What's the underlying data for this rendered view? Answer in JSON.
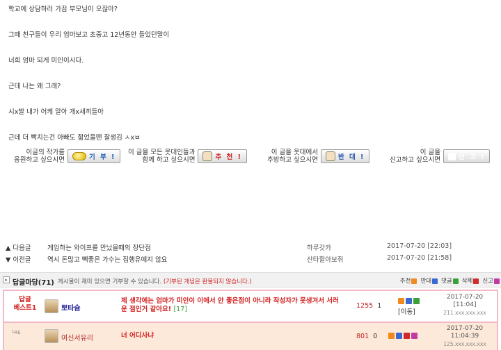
{
  "story": {
    "lines": [
      "학교에 상담하러 가끔 부모님이 오잖아?",
      "그때 친구들이 우리 엄마보고 초중고 12년동안 들었던말이",
      "너희 엄마 되게 미인이시다.",
      "근데 나는 왜 그래?",
      "시x발 내가 어케 알아 개x새끼들아",
      "근데 더 빡치는건 아빠도 젊었을땐 잘생김 ㅅxㅂ"
    ]
  },
  "actions": {
    "donate_text_1": "이글의 작가를",
    "donate_text_2": "응원하고 싶으시면",
    "donate_label": "기 부 !",
    "recommend_text_1": "이 글을 모든 웃대인들과",
    "recommend_text_2": "함께 하고 싶으시면",
    "recommend_label": "추 천 !",
    "oppose_text_1": "이 글을 웃대에서",
    "oppose_text_2": "추방하고 싶으시면",
    "oppose_label": "반 대 !",
    "report_text_1": "이 글을",
    "report_text_2": "신고하고 싶으시면",
    "report_label": "신 고 !"
  },
  "nav": {
    "next": {
      "label": "▲ 다음글",
      "title": "게임하는 와이프를 만났을때의 장단점",
      "author": "하루갓카",
      "date": "2017-07-20 [22:03]"
    },
    "prev": {
      "label": "▼ 이전글",
      "title": "역시 돈많고 빽좋은 가수는 집행유예지 않요",
      "author": "산타할아보쥐",
      "date": "2017-07-20 [21:58]"
    }
  },
  "comments": {
    "title": "답글마당(71)",
    "notice": "게시물이 재미 있으면 기부할 수 있습니다.",
    "notice_red": "(기부된 개념은 환불되지 않습니다.)",
    "legend": {
      "recommend": "추천",
      "oppose": "반대",
      "reply": "댓글",
      "delete": "삭제",
      "report": "신고"
    },
    "colors": {
      "recommend": "#f08a1c",
      "oppose": "#3a6ad0",
      "reply": "#3aa13a",
      "delete": "#d02a2a",
      "report": "#c03aa0"
    },
    "best": {
      "badge_1": "답글",
      "badge_2": "베스트1",
      "user": "뽀타슘",
      "text_1": "제 생각에는 엄마가 미인이 이에서 안 좋은점이 아니라 작성자가 못생겨서 서러",
      "text_2": "운 점인거 같아요!",
      "reply_count": "[17]",
      "score": "1255",
      "oppose": "1",
      "move": "[이동]",
      "date": "2017-07-20",
      "time": "[11:04]",
      "ip": "211.xxx.xxx.xxx"
    },
    "reply": {
      "re": "└RE",
      "user": "여신서유리",
      "text": "너 어디사냐",
      "score": "801",
      "oppose": "0",
      "date": "2017-07-20",
      "time": "11:04:39",
      "ip": "125.xxx.xxx.xxx"
    }
  }
}
